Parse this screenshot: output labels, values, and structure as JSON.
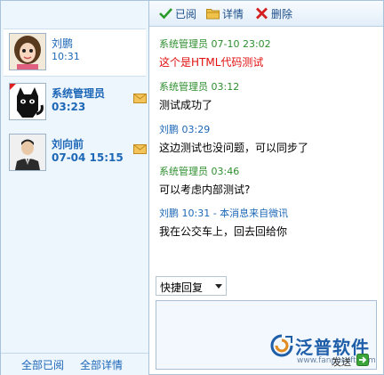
{
  "toolbar": {
    "read_label": "已阅",
    "details_label": "详情",
    "delete_label": "删除"
  },
  "contacts": [
    {
      "name": "刘鹏",
      "time": "10:31",
      "avatar": "girl-avatar"
    },
    {
      "name": "系统管理员",
      "time": "03:23",
      "avatar": "cat-avatar"
    },
    {
      "name": "刘向前",
      "time": "07-04 15:15",
      "avatar": "man-avatar"
    }
  ],
  "left_footer": {
    "mark_all_read": "全部已阅",
    "all_details": "全部详情"
  },
  "messages": [
    {
      "header": "系统管理员 07-10 23:02",
      "body": "这个是HTML代码测试"
    },
    {
      "header": "系统管理员 03:12",
      "body": "测试成功了"
    },
    {
      "header": "刘鹏 03:29",
      "body": "这边测试也没问题，可以同步了"
    },
    {
      "header": "系统管理员 03:46",
      "body": "可以考虑内部测试?"
    },
    {
      "header": "刘鹏 10:31 - 本消息来自微讯",
      "body": "我在公交车上，回去回给你"
    }
  ],
  "quick_reply": {
    "selected": "快捷回复"
  },
  "send": {
    "label": "发送"
  },
  "watermark": {
    "brand": "泛普软件",
    "url": "www.fanpusoft.com"
  },
  "colors": {
    "accent": "#1d67b7",
    "sender_system": "#2f8f2f",
    "html_test": "#e01010"
  }
}
